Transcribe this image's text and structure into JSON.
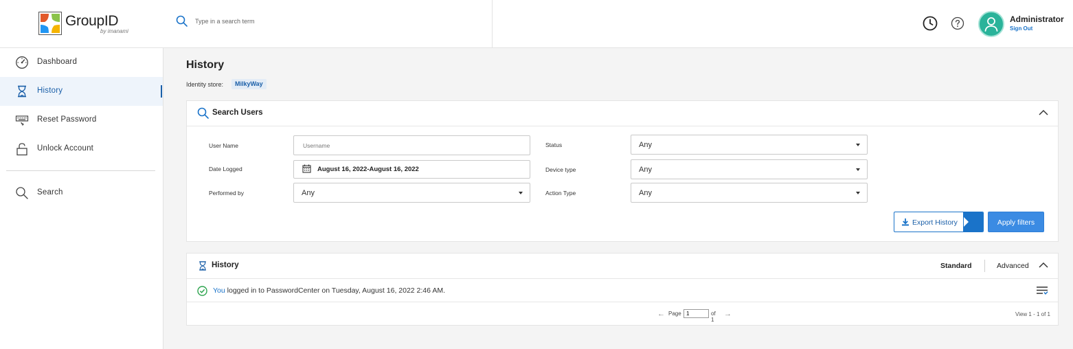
{
  "header": {
    "brand": "GroupID",
    "brand_sub": "by imanami",
    "search_placeholder": "Type in a search term",
    "user_name": "Administrator",
    "sign_out": "Sign Out"
  },
  "sidebar": {
    "items": [
      {
        "label": "Dashboard",
        "icon": "dashboard-icon"
      },
      {
        "label": "History",
        "icon": "hourglass-icon",
        "active": true
      },
      {
        "label": "Reset Password",
        "icon": "keyboard-icon"
      },
      {
        "label": "Unlock Account",
        "icon": "lock-icon"
      },
      {
        "label": "Search",
        "icon": "search-icon"
      }
    ]
  },
  "main": {
    "title": "History",
    "identity_store_label": "Identity store:",
    "identity_store_value": "MilkyWay",
    "search_panel": {
      "title": "Search Users",
      "fields": {
        "user_name_label": "User Name",
        "user_name_placeholder": "Username",
        "date_logged_label": "Date Logged",
        "date_logged_value": "August 16, 2022-August 16, 2022",
        "performed_by_label": "Performed by",
        "performed_by_value": "Any",
        "status_label": "Status",
        "status_value": "Any",
        "device_type_label": "Device type",
        "device_type_value": "Any",
        "action_type_label": "Action Type",
        "action_type_value": "Any"
      },
      "export_label": "Export History",
      "apply_label": "Apply filters"
    },
    "history_panel": {
      "title": "History",
      "tab_standard": "Standard",
      "tab_advanced": "Advanced",
      "entry_actor": "You",
      "entry_text": "logged in to PasswordCenter on Tuesday, August 16, 2022 2:46 AM.",
      "pager_page_label": "Page",
      "pager_page_value": "1",
      "pager_of_label": "of 1",
      "view_count": "View 1 - 1 of 1"
    }
  },
  "colors": {
    "accent": "#1a73c9",
    "apply_button": "#3b8be3",
    "avatar": "#2ab39a",
    "success": "#2ea44f"
  }
}
